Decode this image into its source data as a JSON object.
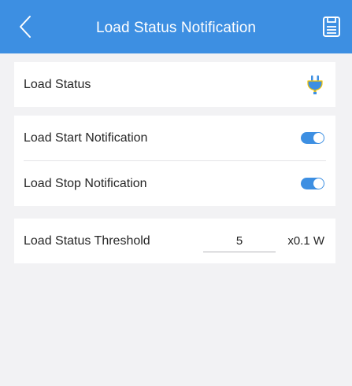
{
  "header": {
    "title": "Load Status Notification",
    "back_icon": "chevron-left-icon",
    "save_icon": "save-document-icon",
    "background_color": "#3d8fe2"
  },
  "status_card": {
    "label": "Load Status",
    "status_icon": "plug-icon",
    "icon_color": "#3d8fe2"
  },
  "notification_card": {
    "items": [
      {
        "label": "Load Start Notification",
        "enabled": true
      },
      {
        "label": "Load Stop Notification",
        "enabled": true
      }
    ],
    "toggle_color": "#3d8fe2"
  },
  "threshold_card": {
    "label": "Load Status Threshold",
    "value": "5",
    "unit": "x0.1 W"
  }
}
